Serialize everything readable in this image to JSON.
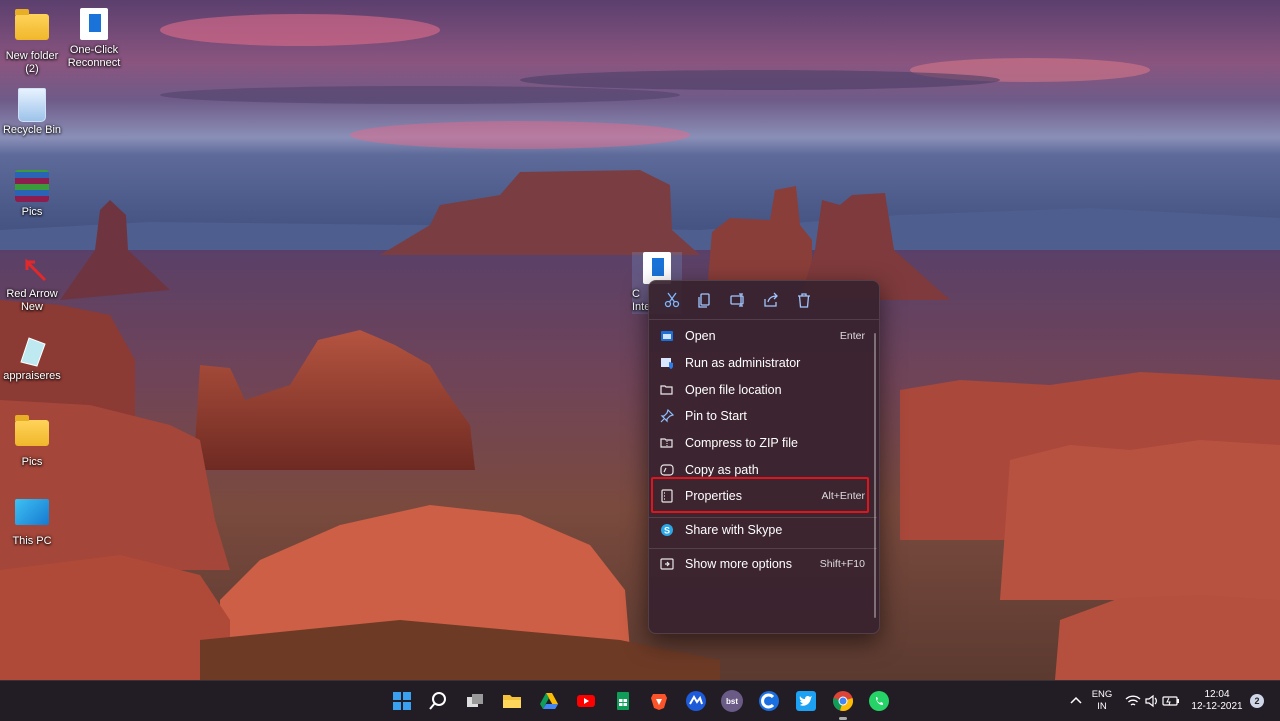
{
  "desktop": {
    "icons": [
      {
        "label": "New folder (2)",
        "icon": "folder-icon"
      },
      {
        "label": "One-Click Reconnect",
        "icon": "shortcut-icon"
      },
      {
        "label": "Recycle Bin",
        "icon": "recycle-bin-icon"
      },
      {
        "label": "Pics",
        "icon": "winrar-icon"
      },
      {
        "label": "Red Arrow New",
        "icon": "red-arrow-icon"
      },
      {
        "label": "appraiseres",
        "icon": "glass-icon"
      },
      {
        "label": "Pics",
        "icon": "folder-icon"
      },
      {
        "label": "This PC",
        "icon": "monitor-icon"
      }
    ],
    "selected_icon_partial_label": "C\nInte"
  },
  "context_menu": {
    "toolbar": [
      "cut-icon",
      "copy-icon",
      "rename-icon",
      "share-icon",
      "delete-icon"
    ],
    "items": [
      {
        "label": "Open",
        "shortcut": "Enter",
        "icon": "open-icon"
      },
      {
        "label": "Run as administrator",
        "shortcut": "",
        "icon": "shield-icon"
      },
      {
        "label": "Open file location",
        "shortcut": "",
        "icon": "folder-open-icon"
      },
      {
        "label": "Pin to Start",
        "shortcut": "",
        "icon": "pin-icon"
      },
      {
        "label": "Compress to ZIP file",
        "shortcut": "",
        "icon": "zip-icon"
      },
      {
        "label": "Copy as path",
        "shortcut": "",
        "icon": "copy-path-icon"
      },
      {
        "label": "Properties",
        "shortcut": "Alt+Enter",
        "icon": "properties-icon"
      },
      {
        "label": "Share with Skype",
        "shortcut": "",
        "icon": "skype-icon"
      },
      {
        "label": "Show more options",
        "shortcut": "Shift+F10",
        "icon": "more-options-icon"
      }
    ],
    "highlight_color": "#e0141c"
  },
  "taskbar": {
    "apps": [
      "windows-start-icon",
      "search-icon",
      "task-view-icon",
      "file-explorer-icon",
      "google-drive-icon",
      "youtube-icon",
      "sheets-icon",
      "brave-icon",
      "app-icon",
      "bst-icon",
      "ccleaner-icon",
      "twitter-icon",
      "chrome-icon",
      "whatsapp-icon"
    ],
    "bst_label": "bst",
    "lang": "ENG",
    "region": "IN",
    "time": "12:04",
    "date": "12-12-2021",
    "notification_count": "2"
  }
}
